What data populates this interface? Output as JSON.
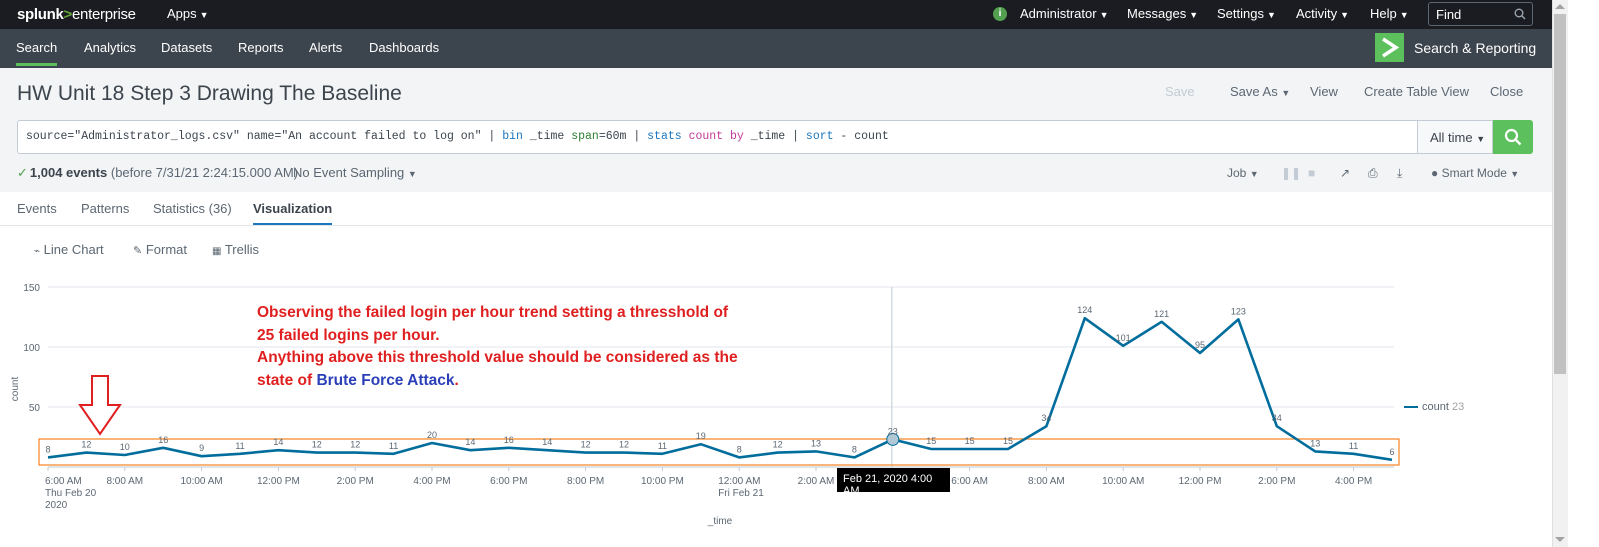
{
  "topbar": {
    "logo_brand": "splunk",
    "logo_gt": ">",
    "logo_product": "enterprise",
    "apps_label": "Apps",
    "admin_label": "Administrator",
    "messages_label": "Messages",
    "settings_label": "Settings",
    "activity_label": "Activity",
    "help_label": "Help",
    "find_placeholder": "Find",
    "status_glyph": "i"
  },
  "appbar": {
    "nav": [
      "Search",
      "Analytics",
      "Datasets",
      "Reports",
      "Alerts",
      "Dashboards"
    ],
    "active": "Search",
    "app_name": "Search & Reporting"
  },
  "header": {
    "title": "HW Unit 18 Step 3 Drawing The Baseline",
    "actions": {
      "save": "Save",
      "save_as": "Save As",
      "view": "View",
      "create_table_view": "Create Table View",
      "close": "Close"
    }
  },
  "search": {
    "query_parts": {
      "p1": "source=\"Administrator_logs.csv\" name=\"An account failed to log on\" | ",
      "p2": "bin",
      "p3": " _time ",
      "p4": "span",
      "p5": "=60m | ",
      "p6": "stats",
      "p7": " ",
      "p8": "count",
      "p9": " ",
      "p10": "by",
      "p11": " _time | ",
      "p12": "sort",
      "p13": " - count"
    },
    "time_range": "All time"
  },
  "status": {
    "events_count": "1,004 events",
    "events_suffix": "(before 7/31/21 2:24:15.000 AM)",
    "sampling": "No Event Sampling",
    "job_label": "Job",
    "mode_label": "Smart Mode"
  },
  "tabs": [
    "Events",
    "Patterns",
    "Statistics (36)",
    "Visualization"
  ],
  "active_tab": "Visualization",
  "viz_toolbar": {
    "chart_type": "Line Chart",
    "format": "Format",
    "trellis": "Trellis"
  },
  "annotation": {
    "line1": "Observing the failed login per hour trend setting a thresshold of",
    "line2": "25 failed logins per hour.",
    "line3": "Anything above this threshold value should be considered as the",
    "line4_prefix": "state of ",
    "line4_highlight": "Brute Force Attack",
    "line4_suffix": "."
  },
  "tooltip": "Feb 21, 2020 4:00 AM",
  "legend": {
    "name": "count",
    "value": "23"
  },
  "colors": {
    "line": "#006d9c",
    "threshold_box": "#f58220",
    "annotation_red": "#e02020",
    "annotation_blue": "#2a3fb8",
    "arrow": "#e02020",
    "accent_green": "#5cc05c"
  },
  "chart_data": {
    "type": "line",
    "ylabel": "count",
    "xlabel": "_time",
    "ylim": [
      0,
      150
    ],
    "yticks": [
      50,
      100,
      150
    ],
    "x_tick_labels": [
      {
        "label": "6:00 AM",
        "sub1": "Thu Feb 20",
        "sub2": "2020",
        "index": 0
      },
      {
        "label": "8:00 AM",
        "index": 2
      },
      {
        "label": "10:00 AM",
        "index": 4
      },
      {
        "label": "12:00 PM",
        "index": 6
      },
      {
        "label": "2:00 PM",
        "index": 8
      },
      {
        "label": "4:00 PM",
        "index": 10
      },
      {
        "label": "6:00 PM",
        "index": 12
      },
      {
        "label": "8:00 PM",
        "index": 14
      },
      {
        "label": "10:00 PM",
        "index": 16
      },
      {
        "label": "12:00 AM",
        "sub1": "Fri Feb 21",
        "index": 18
      },
      {
        "label": "2:00 AM",
        "index": 20
      },
      {
        "label": "4:00 AM",
        "index": 22
      },
      {
        "label": "6:00 AM",
        "index": 24
      },
      {
        "label": "8:00 AM",
        "index": 26
      },
      {
        "label": "10:00 AM",
        "index": 28
      },
      {
        "label": "12:00 PM",
        "index": 30
      },
      {
        "label": "2:00 PM",
        "index": 32
      },
      {
        "label": "4:00 PM",
        "index": 34
      }
    ],
    "series": [
      {
        "name": "count",
        "values": [
          8,
          12,
          10,
          16,
          9,
          11,
          14,
          12,
          12,
          11,
          20,
          14,
          16,
          14,
          12,
          12,
          11,
          19,
          8,
          12,
          13,
          8,
          23,
          15,
          15,
          15,
          34,
          124,
          101,
          121,
          95,
          123,
          34,
          13,
          11,
          6
        ]
      }
    ],
    "grid": true,
    "legend_position": "right"
  }
}
